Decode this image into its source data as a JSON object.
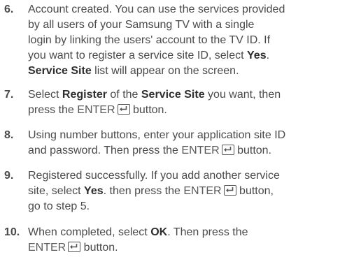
{
  "steps": [
    {
      "number": "6.",
      "lines": [
        [
          {
            "t": "Account created. You can use the services provided"
          }
        ],
        [
          {
            "t": "by all users of your Samsung TV with a single"
          }
        ],
        [
          {
            "t": "login by linking the users' account to the TV ID. If"
          }
        ],
        [
          {
            "t": "you want to register a service site ID, select "
          },
          {
            "t": "Yes",
            "b": true
          },
          {
            "t": "."
          }
        ],
        [
          {
            "t": "Service Site",
            "b": true
          },
          {
            "t": " list will appear on the screen."
          }
        ]
      ]
    },
    {
      "number": "7.",
      "lines": [
        [
          {
            "t": "Select "
          },
          {
            "t": "Register",
            "b": true
          },
          {
            "t": " of the "
          },
          {
            "t": "Service Site",
            "b": true
          },
          {
            "t": " you want, then"
          }
        ],
        [
          {
            "t": "press the "
          },
          {
            "t": "ENTER",
            "enter": true
          },
          {
            "t": " button."
          }
        ]
      ]
    },
    {
      "number": "8.",
      "lines": [
        [
          {
            "t": "Using number buttons, enter your application site ID"
          }
        ],
        [
          {
            "t": "and password. Then press the "
          },
          {
            "t": "ENTER",
            "enter": true
          },
          {
            "t": " button."
          }
        ]
      ]
    },
    {
      "number": "9.",
      "lines": [
        [
          {
            "t": "Registered successfully. If you add another service"
          }
        ],
        [
          {
            "t": "site, select "
          },
          {
            "t": "Yes",
            "b": true
          },
          {
            "t": ". then press the "
          },
          {
            "t": "ENTER",
            "enter": true
          },
          {
            "t": " button,"
          }
        ],
        [
          {
            "t": "go to step 5."
          }
        ]
      ]
    },
    {
      "number": "10.",
      "lines": [
        [
          {
            "t": "When completed, select "
          },
          {
            "t": "OK",
            "b": true
          },
          {
            "t": ". Then press the"
          }
        ],
        [
          {
            "t": "ENTER",
            "enter": true
          },
          {
            "t": "  button."
          }
        ]
      ]
    }
  ]
}
